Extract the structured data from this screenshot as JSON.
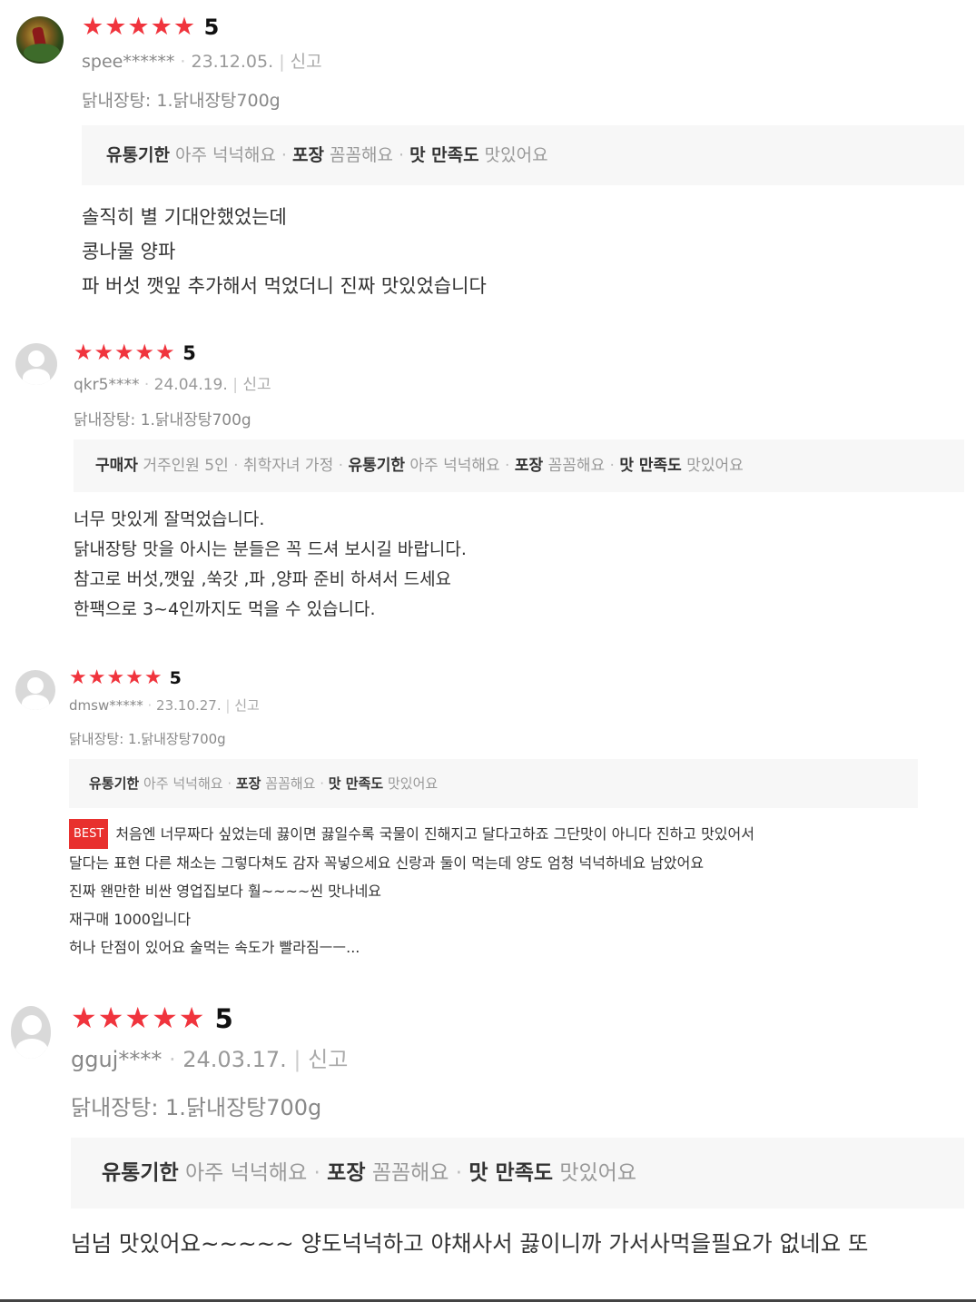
{
  "reviews": [
    {
      "avatar": "user-photo",
      "stars": "★★★★★",
      "score": "5",
      "user": "spee******",
      "date": "23.12.05.",
      "report": "신고",
      "option": "닭내장탕: 1.닭내장탕700g",
      "tags": [
        {
          "k": "유통기한",
          "v": "아주 넉넉해요"
        },
        {
          "k": "포장",
          "v": "꼼꼼해요"
        },
        {
          "k": "맛 만족도",
          "v": "맛있어요"
        }
      ],
      "best": "",
      "lines": [
        "솔직히 별 기대안했었는데",
        "콩나물 양파",
        "파 버섯 깻잎 추가해서 먹었더니 진짜 맛있었습니다"
      ]
    },
    {
      "avatar": "default-avatar",
      "stars": "★★★★★",
      "score": "5",
      "user": "qkr5****",
      "date": "24.04.19.",
      "report": "신고",
      "option": "닭내장탕: 1.닭내장탕700g",
      "tags": [
        {
          "k": "구매자",
          "v": "거주인원 5인"
        },
        {
          "k": "",
          "v": "취학자녀 가정"
        },
        {
          "k": "유통기한",
          "v": "아주 넉넉해요"
        },
        {
          "k": "포장",
          "v": "꼼꼼해요"
        },
        {
          "k": "맛 만족도",
          "v": "맛있어요"
        }
      ],
      "best": "",
      "lines": [
        "너무 맛있게 잘먹었습니다.",
        "닭내장탕 맛을 아시는 분들은 꼭 드셔 보시길 바랍니다.",
        "참고로 버섯,깻잎 ,쑥갓 ,파 ,양파 준비 하셔서 드세요",
        "한팩으로 3~4인까지도 먹을 수 있습니다."
      ]
    },
    {
      "avatar": "default-avatar",
      "stars": "★★★★★",
      "score": "5",
      "user": "dmsw*****",
      "date": "23.10.27.",
      "report": "신고",
      "option": "닭내장탕: 1.닭내장탕700g",
      "tags": [
        {
          "k": "유통기한",
          "v": "아주 넉넉해요"
        },
        {
          "k": "포장",
          "v": "꼼꼼해요"
        },
        {
          "k": "맛 만족도",
          "v": "맛있어요"
        }
      ],
      "best": "BEST",
      "lines": [
        "처음엔 너무짜다 싶었는데 끓이면 끓일수록 국물이 진해지고 달다고하죠 그단맛이 아니다 진하고 맛있어서",
        "달다는 표현 다른 채소는 그렇다쳐도 감자 꼭넣으세요 신랑과 둘이 먹는데 양도 엄청 넉넉하네요 남았어요",
        "진짜 왠만한 비싼 영업집보다 훨~~~~씬 맛나네요",
        "재구매 1000입니다",
        "허나 단점이 있어요 술먹는 속도가 빨라짐ㅡㅡ..."
      ]
    },
    {
      "avatar": "default-avatar",
      "stars": "★★★★★",
      "score": "5",
      "user": "gguj****",
      "date": "24.03.17.",
      "report": "신고",
      "option": "닭내장탕: 1.닭내장탕700g",
      "tags": [
        {
          "k": "유통기한",
          "v": "아주 넉넉해요"
        },
        {
          "k": "포장",
          "v": "꼼꼼해요"
        },
        {
          "k": "맛 만족도",
          "v": "맛있어요"
        }
      ],
      "best": "",
      "lines": [
        "넘넘 맛있어요~~~~~ 양도넉넉하고 야채사서 끓이니까 가서사먹을필요가 없네요 또"
      ]
    }
  ]
}
